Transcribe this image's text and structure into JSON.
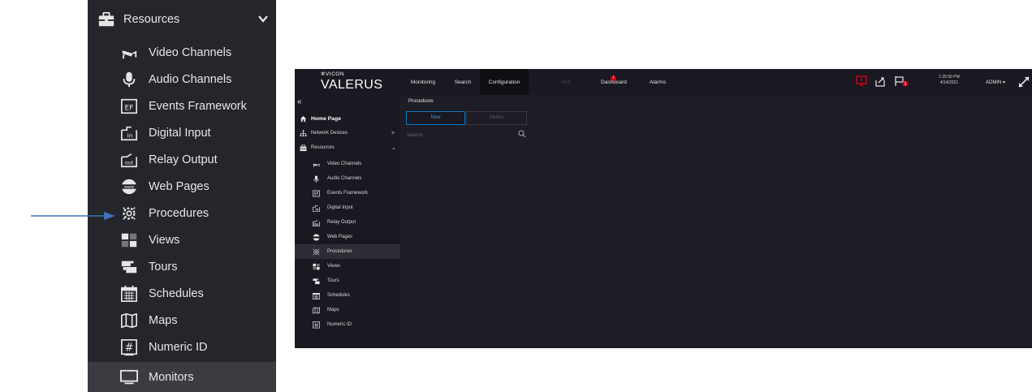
{
  "zoom_sidebar": {
    "header": {
      "label": "Resources",
      "icon": "briefcase-icon"
    },
    "items": [
      {
        "label": "Video Channels",
        "icon": "camera-icon"
      },
      {
        "label": "Audio Channels",
        "icon": "microphone-icon"
      },
      {
        "label": "Events Framework",
        "icon": "events-framework-icon",
        "icon_text": "EF"
      },
      {
        "label": "Digital Input",
        "icon": "digital-input-icon",
        "icon_text": "in"
      },
      {
        "label": "Relay Output",
        "icon": "relay-output-icon",
        "icon_text": "out"
      },
      {
        "label": "Web Pages",
        "icon": "globe-icon",
        "icon_text": "www"
      },
      {
        "label": "Procedures",
        "icon": "procedures-gear-icon"
      },
      {
        "label": "Views",
        "icon": "views-grid-icon"
      },
      {
        "label": "Tours",
        "icon": "tours-icon"
      },
      {
        "label": "Schedules",
        "icon": "calendar-icon"
      },
      {
        "label": "Maps",
        "icon": "map-icon"
      },
      {
        "label": "Numeric ID",
        "icon": "numeric-id-icon",
        "icon_text": "#"
      },
      {
        "label": "Monitors",
        "icon": "monitor-icon",
        "active": true
      }
    ]
  },
  "app": {
    "brand": {
      "small": "✲VICON",
      "big": "VALERUS"
    },
    "nav": [
      {
        "label": "Monitoring"
      },
      {
        "label": "Search"
      },
      {
        "label": "Configuration",
        "active": true
      },
      {
        "label": "VAX",
        "disabled": true
      },
      {
        "label": "Dashboard",
        "badge": "!"
      },
      {
        "label": "Alarms"
      }
    ],
    "top_icons": [
      "monitor-alert-icon",
      "export-icon",
      "flag-icon"
    ],
    "flag_badge": "1",
    "clock": {
      "time": "1:25:50 PM",
      "date": "4/14/2021"
    },
    "user": {
      "label": "ADMIN ▾"
    },
    "sidebar": {
      "collapse_label": "«",
      "top_items": [
        {
          "label": "Home Page",
          "icon": "home-icon"
        },
        {
          "label": "Network Devices",
          "icon": "network-icon",
          "chevron": ">"
        },
        {
          "label": "Resources",
          "icon": "briefcase-icon",
          "chevron": "⌄"
        }
      ],
      "items": [
        {
          "label": "Video Channels"
        },
        {
          "label": "Audio Channels"
        },
        {
          "label": "Events Framework"
        },
        {
          "label": "Digital Input"
        },
        {
          "label": "Relay Output"
        },
        {
          "label": "Web Pages"
        },
        {
          "label": "Procedures",
          "active": true
        },
        {
          "label": "Views"
        },
        {
          "label": "Tours"
        },
        {
          "label": "Schedules"
        },
        {
          "label": "Maps"
        },
        {
          "label": "Numeric ID"
        }
      ]
    },
    "content": {
      "title": "Procedures",
      "new_label": "New",
      "delete_label": "Delete",
      "search_placeholder": "Search..."
    }
  },
  "colors": {
    "accent": "#0a78c8",
    "arrow": "#3b73b9",
    "badge": "#d0021b",
    "panel": "#24262b"
  }
}
